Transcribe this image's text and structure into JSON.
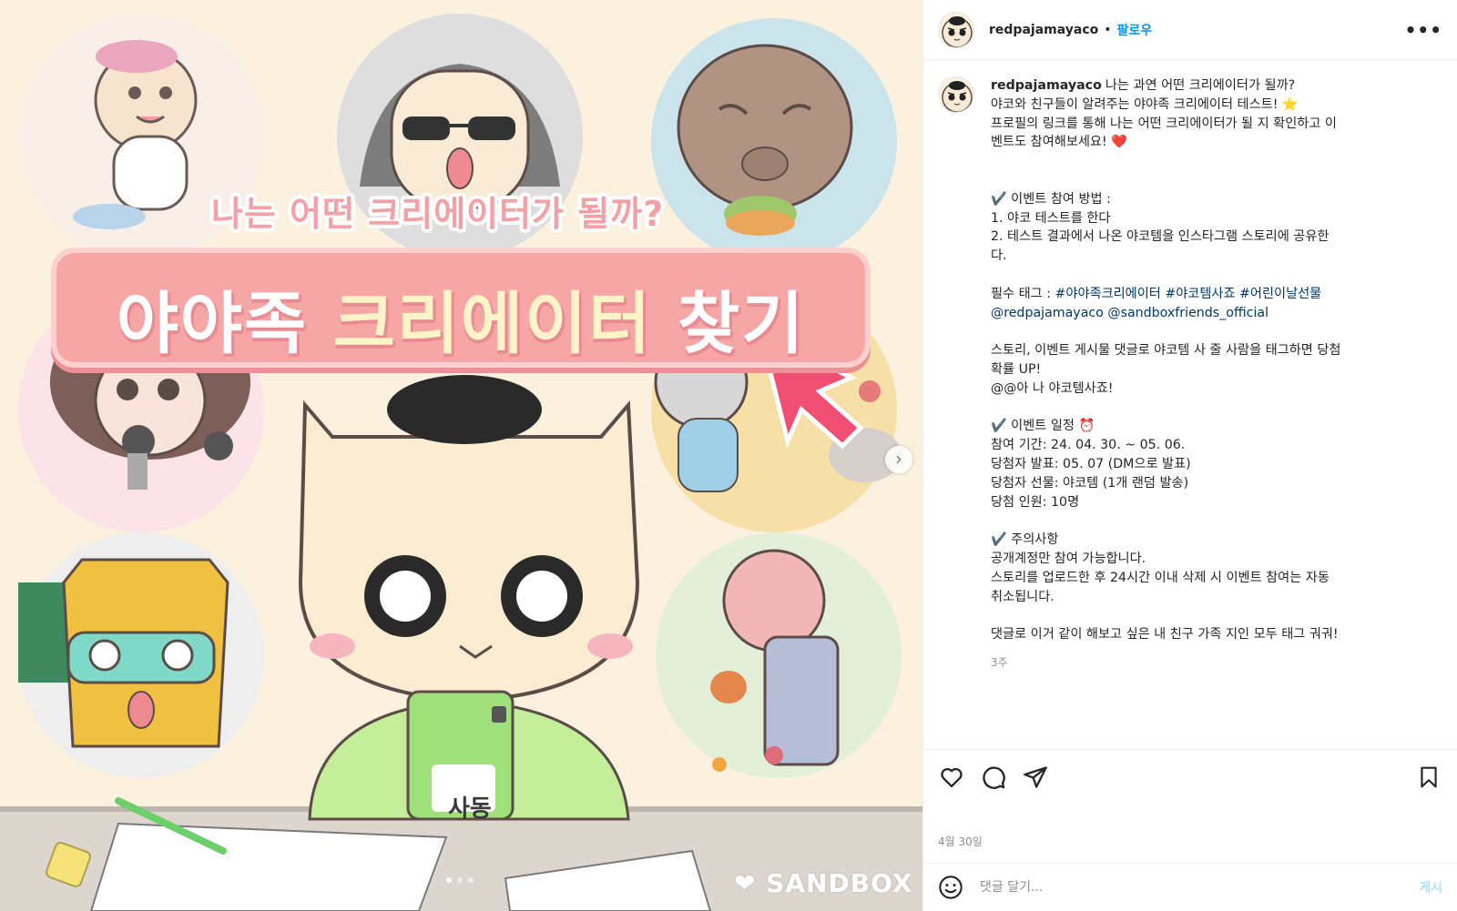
{
  "colors": {
    "follow_blue": "#0095f6",
    "hashtag": "#00376b",
    "muted": "#8e8e8e",
    "banner_pink": "#f7a6a6",
    "media_bg": "#fbf1de"
  },
  "media": {
    "headline": "나는 어떤 크리에이터가 될까?",
    "banner_part1": "야야족 ",
    "banner_highlight": "크리에이터",
    "banner_part2": " 찾기",
    "phone_badge": "사동",
    "watermark": "SANDBOX",
    "next_icon": "chevron-right-icon",
    "carousel_total": 3,
    "carousel_active": 1
  },
  "header": {
    "username": "redpajamayaco",
    "separator": "•",
    "follow": "팔로우",
    "more": "•••"
  },
  "caption": {
    "username": "redpajamayaco",
    "lines": [
      "나는 과연 어떤 크리에이터가 될까?",
      "야코와 친구들이 알려주는 야야족 크리에이터 테스트! ⭐",
      "프로필의 링크를 통해 나는 어떤 크리에이터가 될 지 확인하고 이",
      "벤트도 참여해보세요! ❤️"
    ],
    "howto_title": "✔️ 이벤트 참여 방법 :",
    "howto_1": "1. 야코 테스트를 한다",
    "howto_2a": "2. 테스트 결과에서 나온 야코템을 인스타그램 스토리에 공유한",
    "howto_2b": "다.",
    "tag_label": "필수 태그 : ",
    "hashtags": [
      "#야야족크리에이터",
      "#야코템사죠",
      "#어린이날선물"
    ],
    "mentions": [
      "@redpajamayaco",
      "@sandboxfriends_official"
    ],
    "story_1": "스토리, 이벤트 게시물 댓글로 야코템 사 줄 사람을 태그하면 당첨",
    "story_2": "확률 UP!",
    "story_3": "@@아 나 야코템사죠!",
    "schedule_title": "✔️ 이벤트 일정 ⏰",
    "schedule_1": "참여 기간: 24. 04. 30. ~ 05. 06.",
    "schedule_2": "당첨자 발표: 05. 07 (DM으로 발표)",
    "schedule_3": "당첨자 선물: 야코템 (1개 랜덤 발송)",
    "schedule_4": "당첨 인원: 10명",
    "notice_title": "✔️ 주의사항",
    "notice_1": "공개계정만 참여 가능합니다.",
    "notice_2": "스토리를 업로드한 후 24시간 이내 삭제 시 이벤트 참여는 자동",
    "notice_3": "취소됩니다.",
    "closing": "댓글로 이거 같이 해보고 싶은 내 친구 가족 지인 모두 태그 궈궈!",
    "time_ago": "3주"
  },
  "actions": {
    "like_icon": "heart-icon",
    "comment_icon": "comment-icon",
    "share_icon": "share-icon",
    "save_icon": "bookmark-icon"
  },
  "date": "4월 30일",
  "comment": {
    "placeholder": "댓글 달기...",
    "post": "게시",
    "emoji_icon": "emoji-icon"
  }
}
